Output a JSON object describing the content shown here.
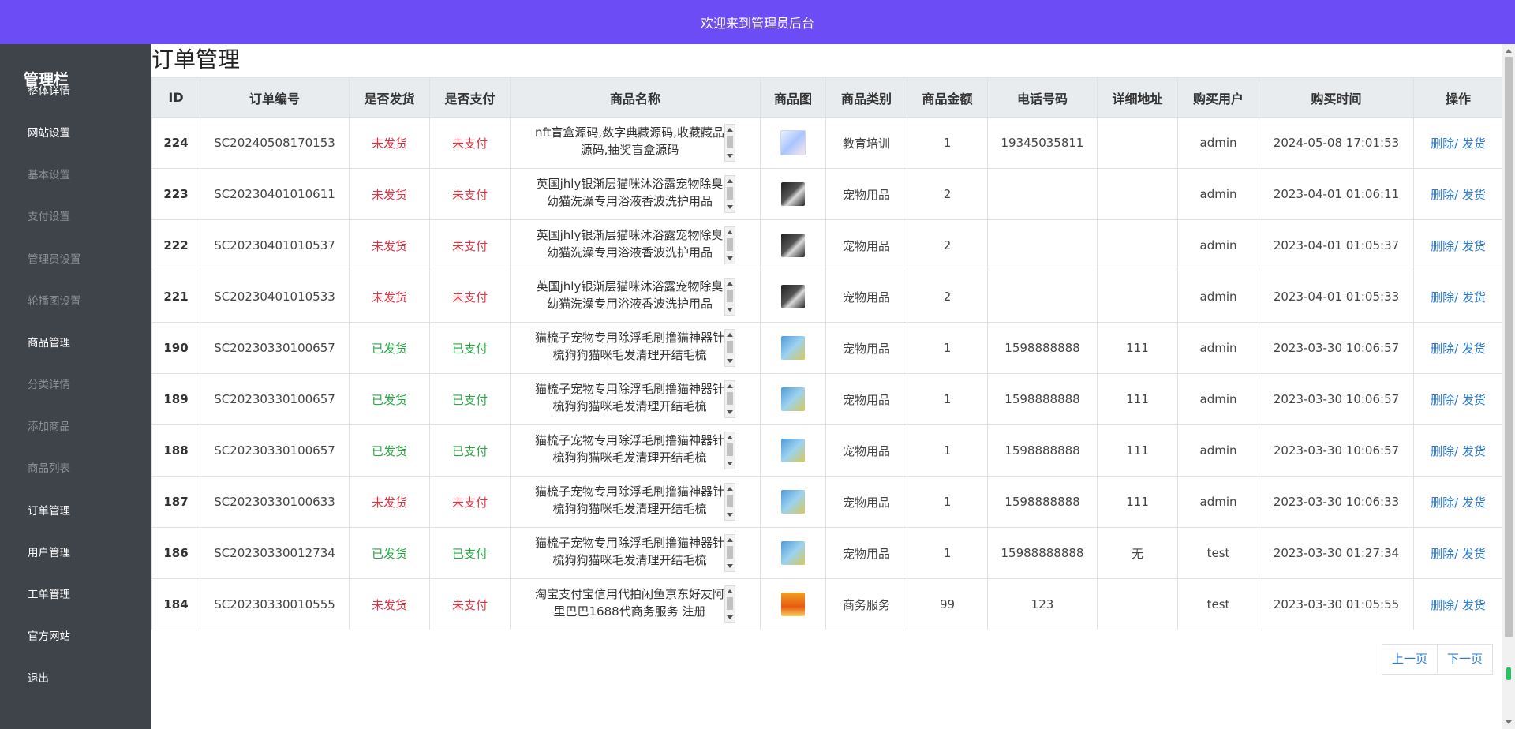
{
  "header": {
    "title": "欢迎来到管理员后台"
  },
  "sidebar": {
    "brand": "管理栏",
    "items": [
      {
        "label": "整体详情",
        "sub": false
      },
      {
        "label": "网站设置",
        "sub": false
      },
      {
        "label": "基本设置",
        "sub": true
      },
      {
        "label": "支付设置",
        "sub": true
      },
      {
        "label": "管理员设置",
        "sub": true
      },
      {
        "label": "轮播图设置",
        "sub": true
      },
      {
        "label": "商品管理",
        "sub": false
      },
      {
        "label": "分类详情",
        "sub": true
      },
      {
        "label": "添加商品",
        "sub": true
      },
      {
        "label": "商品列表",
        "sub": true
      },
      {
        "label": "订单管理",
        "sub": false
      },
      {
        "label": "用户管理",
        "sub": false
      },
      {
        "label": "工单管理",
        "sub": false
      },
      {
        "label": "官方网站",
        "sub": false
      },
      {
        "label": "退出",
        "sub": false
      }
    ]
  },
  "page": {
    "title": "订单管理"
  },
  "table": {
    "headers": [
      "ID",
      "订单编号",
      "是否发货",
      "是否支付",
      "商品名称",
      "商品图",
      "商品类别",
      "商品金额",
      "电话号码",
      "详细地址",
      "购买用户",
      "购买时间",
      "操作"
    ],
    "delete_label": "删除",
    "ship_label": "发货",
    "rows": [
      {
        "id": "224",
        "order_no": "SC20240508170153",
        "shipped": "未发货",
        "paid": "未支付",
        "name": "nft盲盒源码,数字典藏源码,收藏藏品源码,抽奖盲盒源码",
        "img": "edu-image",
        "category": "教育培训",
        "amount": "1",
        "phone": "19345035811",
        "address": "",
        "user": "admin",
        "time": "2024-05-08 17:01:53"
      },
      {
        "id": "223",
        "order_no": "SC20230401010611",
        "shipped": "未发货",
        "paid": "未支付",
        "name": "英国jhly银渐层猫咪沐浴露宠物除臭幼猫洗澡专用浴液香波洗护用品",
        "img": "pet-image",
        "category": "宠物用品",
        "amount": "2",
        "phone": "",
        "address": "",
        "user": "admin",
        "time": "2023-04-01 01:06:11"
      },
      {
        "id": "222",
        "order_no": "SC20230401010537",
        "shipped": "未发货",
        "paid": "未支付",
        "name": "英国jhly银渐层猫咪沐浴露宠物除臭幼猫洗澡专用浴液香波洗护用品",
        "img": "pet-image",
        "category": "宠物用品",
        "amount": "2",
        "phone": "",
        "address": "",
        "user": "admin",
        "time": "2023-04-01 01:05:37"
      },
      {
        "id": "221",
        "order_no": "SC20230401010533",
        "shipped": "未发货",
        "paid": "未支付",
        "name": "英国jhly银渐层猫咪沐浴露宠物除臭幼猫洗澡专用浴液香波洗护用品",
        "img": "pet-image",
        "category": "宠物用品",
        "amount": "2",
        "phone": "",
        "address": "",
        "user": "admin",
        "time": "2023-04-01 01:05:33"
      },
      {
        "id": "190",
        "order_no": "SC20230330100657",
        "shipped": "已发货",
        "paid": "已支付",
        "name": "猫梳子宠物专用除浮毛刷撸猫神器针梳狗狗猫咪毛发清理开结毛梳",
        "img": "comb-image",
        "category": "宠物用品",
        "amount": "1",
        "phone": "1598888888",
        "address": "111",
        "user": "admin",
        "time": "2023-03-30 10:06:57"
      },
      {
        "id": "189",
        "order_no": "SC20230330100657",
        "shipped": "已发货",
        "paid": "已支付",
        "name": "猫梳子宠物专用除浮毛刷撸猫神器针梳狗狗猫咪毛发清理开结毛梳",
        "img": "comb-image",
        "category": "宠物用品",
        "amount": "1",
        "phone": "1598888888",
        "address": "111",
        "user": "admin",
        "time": "2023-03-30 10:06:57"
      },
      {
        "id": "188",
        "order_no": "SC20230330100657",
        "shipped": "已发货",
        "paid": "已支付",
        "name": "猫梳子宠物专用除浮毛刷撸猫神器针梳狗狗猫咪毛发清理开结毛梳",
        "img": "comb-image",
        "category": "宠物用品",
        "amount": "1",
        "phone": "1598888888",
        "address": "111",
        "user": "admin",
        "time": "2023-03-30 10:06:57"
      },
      {
        "id": "187",
        "order_no": "SC20230330100633",
        "shipped": "未发货",
        "paid": "未支付",
        "name": "猫梳子宠物专用除浮毛刷撸猫神器针梳狗狗猫咪毛发清理开结毛梳",
        "img": "comb-image",
        "category": "宠物用品",
        "amount": "1",
        "phone": "1598888888",
        "address": "111",
        "user": "admin",
        "time": "2023-03-30 10:06:33"
      },
      {
        "id": "186",
        "order_no": "SC20230330012734",
        "shipped": "已发货",
        "paid": "已支付",
        "name": "猫梳子宠物专用除浮毛刷撸猫神器针梳狗狗猫咪毛发清理开结毛梳",
        "img": "comb-image",
        "category": "宠物用品",
        "amount": "1",
        "phone": "15988888888",
        "address": "无",
        "user": "test",
        "time": "2023-03-30 01:27:34"
      },
      {
        "id": "184",
        "order_no": "SC20230330010555",
        "shipped": "未发货",
        "paid": "未支付",
        "name": "淘宝支付宝信用代拍闲鱼京东好友阿里巴巴1688代商务服务 注册",
        "img": "service-image",
        "category": "商务服务",
        "amount": "99",
        "phone": "123",
        "address": "",
        "user": "test",
        "time": "2023-03-30 01:05:55"
      }
    ]
  },
  "pagination": {
    "prev": "上一页",
    "next": "下一页"
  },
  "colors": {
    "topbar": "#6c4cf4",
    "sidebar": "#3f434a",
    "link": "#2a7bd6",
    "negative": "#dc3545",
    "positive": "#28a745"
  }
}
